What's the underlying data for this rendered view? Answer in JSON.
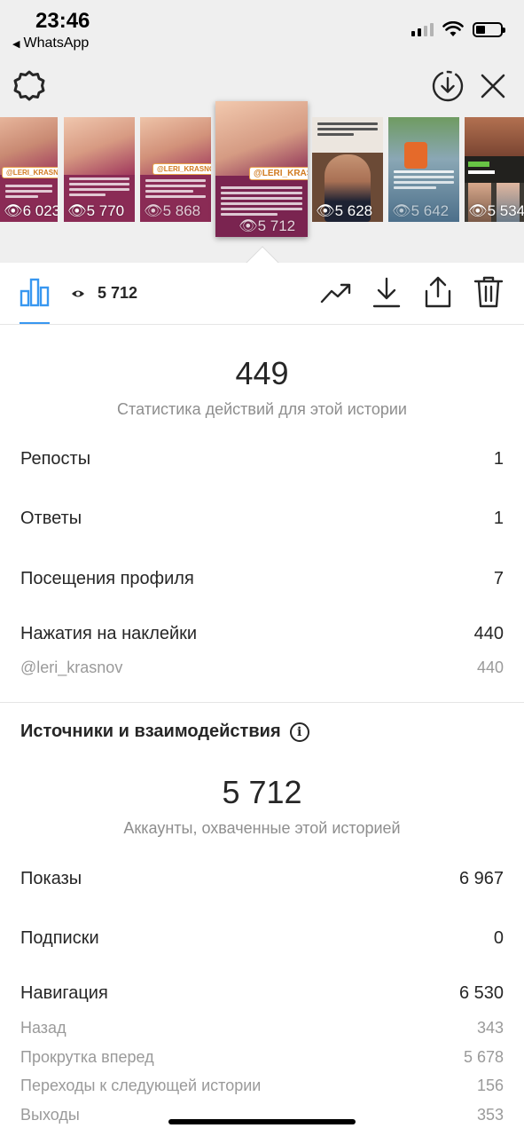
{
  "status_bar": {
    "time": "23:46",
    "back_app": "WhatsApp"
  },
  "top_bar": {
    "settings_icon": "gear-icon",
    "download_icon": "download-circle-icon",
    "close_icon": "close-icon"
  },
  "thumbnails": [
    {
      "views": "6 023",
      "tag": "@LERI_KRASNO"
    },
    {
      "views": "5 770"
    },
    {
      "views": "5 868",
      "tag": "@LERI_KRASNO"
    },
    {
      "views": "5 712",
      "tag": "@LERI_KRASNO",
      "selected": true
    },
    {
      "views": "5 628"
    },
    {
      "views": "5 642"
    },
    {
      "views": "5 534"
    }
  ],
  "toolbar": {
    "views": "5 712",
    "chart_icon": "bar-chart-icon",
    "eye_icon": "eye-icon",
    "promote_icon": "trending-icon",
    "save_icon": "download-icon",
    "share_icon": "share-icon",
    "delete_icon": "trash-icon"
  },
  "actions": {
    "total": "449",
    "caption": "Статистика действий для этой истории",
    "rows": [
      {
        "label": "Репосты",
        "value": "1"
      },
      {
        "label": "Ответы",
        "value": "1"
      },
      {
        "label": "Посещения профиля",
        "value": "7"
      },
      {
        "label": "Нажатия на наклейки",
        "value": "440"
      }
    ],
    "sticker": {
      "label": "@leri_krasnov",
      "value": "440"
    }
  },
  "sources": {
    "title": "Источники и взаимодействия",
    "info_icon": "info-icon",
    "reach": "5 712",
    "caption": "Аккаунты, охваченные этой историей",
    "impressions": {
      "label": "Показы",
      "value": "6 967"
    },
    "follows": {
      "label": "Подписки",
      "value": "0"
    },
    "navigation": {
      "label": "Навигация",
      "value": "6 530"
    },
    "nav_items": [
      {
        "label": "Назад",
        "value": "343"
      },
      {
        "label": "Прокрутка вперед",
        "value": "5 678"
      },
      {
        "label": "Переходы к следующей истории",
        "value": "156"
      },
      {
        "label": "Выходы",
        "value": "353"
      }
    ]
  }
}
